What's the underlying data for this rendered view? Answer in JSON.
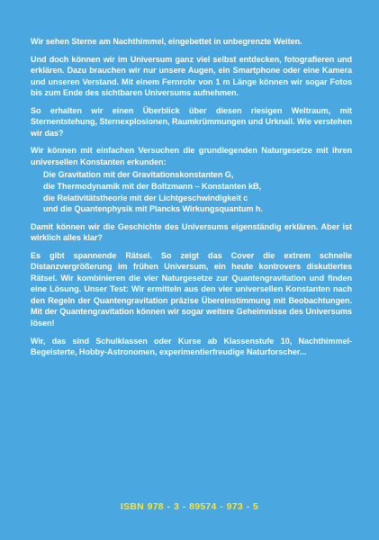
{
  "back_cover": {
    "paragraphs": [
      "Wir sehen Sterne am Nachthimmel, eingebettet in unbegrenzte Weiten.",
      "Und doch können wir im Universum ganz viel selbst entdecken, fotografieren und erklären. Dazu brauchen wir nur unsere Augen, ein Smartphone oder eine Kamera und unseren Verstand. Mit einem Fernrohr von 1 m Länge können wir sogar Fotos bis zum Ende des sichtbaren Universums aufnehmen.",
      "So erhalten wir einen Überblick über diesen riesigen Weltraum, mit Sternentstehung, Sternexplosionen, Raumkrümmungen und Urknall. Wie verstehen wir das?",
      "Wir können mit einfachen Versuchen die grundlegenden Naturgesetze mit ihren universellen Konstanten erkunden:"
    ],
    "laws": [
      "Die Gravitation mit der Gravitationskonstanten G,",
      "die Thermodynamik mit der Boltzmann – Konstanten kB,",
      "die Relativitätstheorie mit der Lichtgeschwindigkeit c",
      "und die Quantenphysik mit Plancks Wirkungsquantum h."
    ],
    "paragraphs_after": [
      "Damit können wir die Geschichte des Universums eigenständig erklären. Aber ist wirklich alles klar?",
      "Es gibt spannende Rätsel. So zeigt das Cover die extrem schnelle Distanzvergrößerung im frühen Universum, ein heute kontrovers diskutiertes Rätsel. Wir kombinieren die vier Naturgesetze zur Quantengravitation und finden eine Lösung. Unser Test: Wir ermitteln aus den vier universellen Konstanten nach den Regeln der Quantengravitation präzise Übereinstimmung mit Beobachtungen. Mit der Quantengravitation können wir sogar weitere Geheimnisse des Universums lösen!",
      "Wir, das sind Schulklassen oder Kurse ab Klassenstufe 10, Nachthimmel-Begeisterte, Hobby-Astronomen, experimentierfreudige Naturforscher..."
    ],
    "isbn": "ISBN 978 - 3 - 89574 - 973 - 5"
  },
  "colors": {
    "background": "#4aa7df",
    "text": "#ffffff",
    "isbn": "#ffe431"
  }
}
